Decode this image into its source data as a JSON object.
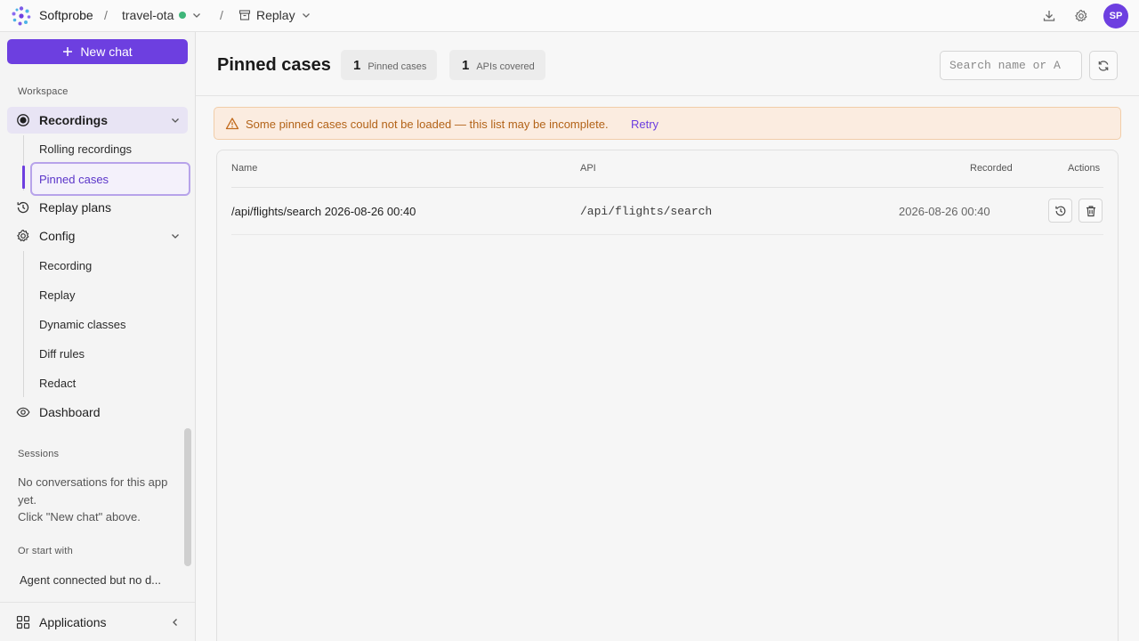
{
  "topbar": {
    "brand": "Softprobe",
    "separator": "/",
    "app_name": "travel-ota",
    "app_status_color": "#3fb67a",
    "section": "Replay",
    "icons": [
      "download-icon",
      "gear-icon"
    ],
    "avatar_initials": "SP"
  },
  "sidebar": {
    "new_chat_label": "New chat",
    "workspace_label": "Workspace",
    "items": {
      "recordings": "Recordings",
      "rolling_recordings": "Rolling recordings",
      "pinned_cases": "Pinned cases",
      "replay_plans": "Replay plans",
      "config": "Config",
      "config_recording": "Recording",
      "config_replay": "Replay",
      "dynamic_classes": "Dynamic classes",
      "diff_rules": "Diff rules",
      "redact": "Redact",
      "dashboard": "Dashboard"
    },
    "sessions_label": "Sessions",
    "sessions_empty_line1": "No conversations for this app yet.",
    "sessions_empty_line2": "Click \"New chat\" above.",
    "start_with_label": "Or start with",
    "start_with_item": "Agent connected but no d...",
    "applications_label": "Applications"
  },
  "main": {
    "title": "Pinned cases",
    "stats": [
      {
        "value": "1",
        "label": "Pinned cases"
      },
      {
        "value": "1",
        "label": "APIs covered"
      }
    ],
    "search_placeholder": "Search name or A",
    "warning_text": "Some pinned cases could not be loaded — this list may be incomplete.",
    "warning_action": "Retry",
    "table": {
      "columns": [
        "Name",
        "API",
        "Recorded",
        "Actions"
      ],
      "rows": [
        {
          "name": "/api/flights/search 2026-08-26 00:40",
          "api": "/api/flights/search",
          "recorded": "2026-08-26 00:40"
        }
      ]
    }
  },
  "colors": {
    "accent": "#6d3fe0",
    "warning_bg": "#fbece0",
    "warning_text": "#b36318"
  }
}
